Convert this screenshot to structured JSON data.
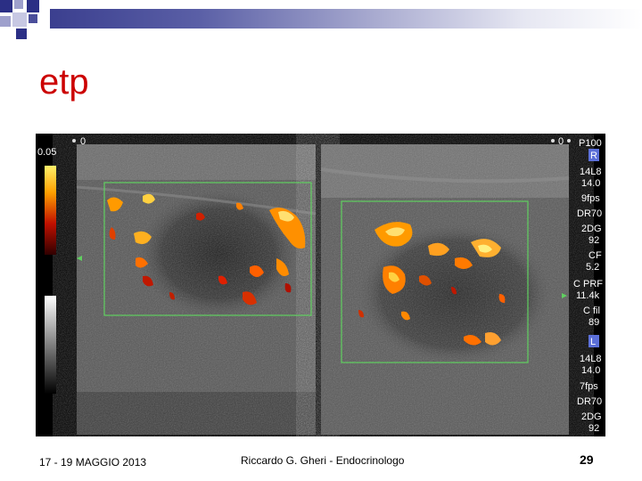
{
  "slide": {
    "title": "etp",
    "footer_date": "17 - 19 MAGGIO 2013",
    "footer_author": "Riccardo G. Gheri - Endocrinologo",
    "page_number": "29"
  },
  "ultrasound": {
    "scale_top": "0.05",
    "depth_zero_left": "0",
    "depth_zero_right": "0",
    "right_probe_label": "P100",
    "marker_R": "R",
    "params_R": [
      "14L8",
      "14.0",
      "9fps",
      "DR70",
      "2DG",
      "92",
      "CF",
      "5.2",
      "C PRF",
      "11.4k",
      "C fil",
      "89"
    ],
    "marker_L": "L",
    "params_L": [
      "14L8",
      "14.0",
      "7fps",
      "DR70",
      "2DG",
      "92"
    ]
  }
}
